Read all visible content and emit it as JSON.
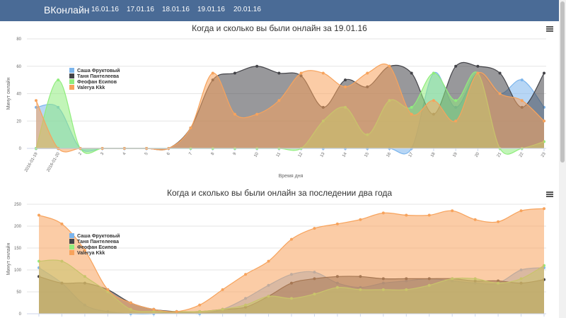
{
  "navbar": {
    "brand": "ВКонлайн",
    "links": [
      "16.01.16",
      "17.01.16",
      "18.01.16",
      "19.01.16",
      "20.01.16"
    ]
  },
  "colors": {
    "navbar": "#4a6b96",
    "series": [
      "#7cb5ec",
      "#434348",
      "#90ed7d",
      "#f7a35c"
    ]
  },
  "chart_data": [
    {
      "type": "area",
      "title": "Когда и сколько вы были онлайн за 19.01.16",
      "xlabel": "Время дня",
      "ylabel": "Минут онлайн",
      "ylim": [
        0,
        80
      ],
      "yticks": [
        "0",
        "20",
        "40",
        "60",
        "80"
      ],
      "categories": [
        "2016-01-19",
        "2016-01-20",
        "2",
        "3",
        "4",
        "5",
        "6",
        "7",
        "8",
        "9",
        "10",
        "11",
        "12",
        "13",
        "14",
        "15",
        "16",
        "17",
        "18",
        "19",
        "20",
        "21",
        "22",
        "23"
      ],
      "legend": "top-left",
      "grid": true,
      "series": [
        {
          "name": "Саша Фруктовый",
          "values": [
            30,
            30,
            0,
            0,
            0,
            0,
            0,
            0,
            0,
            0,
            0,
            0,
            0,
            0,
            0,
            0,
            0,
            0,
            55,
            30,
            55,
            40,
            50,
            30
          ]
        },
        {
          "name": "Таня Пантелеева",
          "values": [
            0,
            0,
            0,
            0,
            0,
            0,
            0,
            15,
            50,
            55,
            60,
            55,
            53,
            30,
            50,
            45,
            60,
            55,
            25,
            60,
            60,
            55,
            30,
            55
          ]
        },
        {
          "name": "Феофан Есипов",
          "values": [
            0,
            50,
            0,
            0,
            0,
            0,
            0,
            0,
            0,
            0,
            0,
            0,
            0,
            20,
            30,
            10,
            35,
            30,
            55,
            35,
            55,
            0,
            0,
            5
          ]
        },
        {
          "name": "Valerya Kkk",
          "values": [
            35,
            0,
            0,
            0,
            0,
            0,
            0,
            15,
            55,
            25,
            25,
            35,
            55,
            55,
            45,
            55,
            60,
            25,
            35,
            20,
            55,
            40,
            35,
            20
          ]
        }
      ]
    },
    {
      "type": "area",
      "title": "Когда и сколько вы были онлайн за последении два года",
      "xlabel": "",
      "ylabel": "Минут онлайн",
      "ylim": [
        0,
        250
      ],
      "yticks": [
        "0",
        "50",
        "100",
        "150",
        "200",
        "250"
      ],
      "legend": "top-left",
      "grid": true,
      "series": [
        {
          "name": "Саша Фруктовый",
          "values": [
            105,
            70,
            20,
            5,
            0,
            0,
            5,
            0,
            10,
            35,
            65,
            90,
            95,
            70,
            60,
            70,
            75,
            80,
            75,
            70,
            70,
            100,
            105
          ]
        },
        {
          "name": "Таня Пантелеева",
          "values": [
            85,
            70,
            70,
            55,
            25,
            10,
            5,
            5,
            10,
            15,
            40,
            70,
            80,
            85,
            85,
            80,
            80,
            80,
            80,
            75,
            75,
            70,
            78
          ]
        },
        {
          "name": "Феофан Есипов",
          "values": [
            120,
            120,
            85,
            50,
            10,
            5,
            5,
            5,
            10,
            20,
            40,
            35,
            45,
            60,
            55,
            55,
            55,
            65,
            80,
            80,
            70,
            80,
            110
          ]
        },
        {
          "name": "Valerya Kkk",
          "values": [
            225,
            205,
            145,
            55,
            25,
            10,
            5,
            20,
            55,
            90,
            120,
            170,
            195,
            205,
            215,
            230,
            225,
            225,
            235,
            215,
            210,
            235,
            240
          ]
        }
      ]
    }
  ]
}
